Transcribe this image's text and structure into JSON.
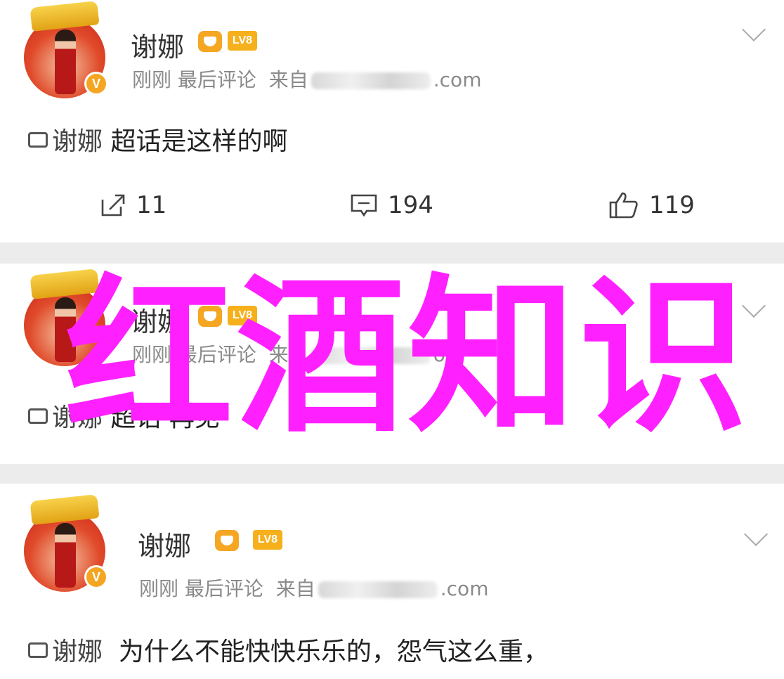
{
  "posts": [
    {
      "name": "谢娜",
      "lv": "LV8",
      "time": "刚刚",
      "activity": "最后评论",
      "source_prefix": "来自",
      "source_suffix": ".com",
      "topic": "谢娜",
      "text": "超话是这样的啊",
      "repost_count": "11",
      "comment_count": "194",
      "like_count": "119"
    },
    {
      "name": "谢娜",
      "lv": "LV8",
      "time": "刚刚",
      "activity": "最后评论",
      "source_prefix": "来自",
      "source_suffix": "om",
      "topic": "谢娜",
      "text": "超话 再见"
    },
    {
      "name": "谢娜",
      "lv": "LV8",
      "time": "刚刚",
      "activity": "最后评论",
      "source_prefix": "来自",
      "source_suffix": ".com",
      "topic": "谢娜",
      "text": "为什么不能快快乐乐的，怨气这么重，"
    }
  ],
  "overlay_text": "红酒知识",
  "colors": {
    "overlay": "#ff20ff",
    "badge_orange": "#f5a623",
    "meta_gray": "#8a8a8a",
    "separator": "#ececec"
  }
}
